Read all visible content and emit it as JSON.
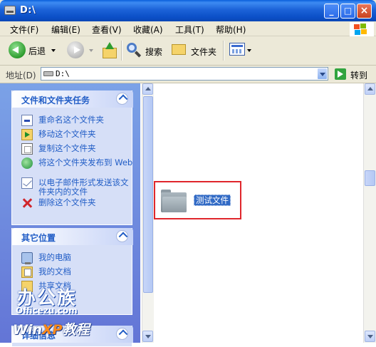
{
  "window": {
    "title": "D:\\"
  },
  "menu": {
    "items": [
      "文件(F)",
      "编辑(E)",
      "查看(V)",
      "收藏(A)",
      "工具(T)",
      "帮助(H)"
    ]
  },
  "toolbar": {
    "back_label": "后退",
    "search_label": "搜索",
    "folders_label": "文件夹"
  },
  "address": {
    "label": "地址(D)",
    "value": "D:\\",
    "go_label": "转到"
  },
  "tasks_panel": {
    "title": "文件和文件夹任务",
    "items": [
      {
        "label": "重命名这个文件夹",
        "icon": "rename-icon"
      },
      {
        "label": "移动这个文件夹",
        "icon": "move-icon"
      },
      {
        "label": "复制这个文件夹",
        "icon": "copy-icon"
      },
      {
        "label": "将这个文件夹发布到 Web",
        "icon": "web-publish-icon"
      },
      {
        "label": "以电子邮件形式发送该文件夹内的文件",
        "icon": "email-icon"
      },
      {
        "label": "删除这个文件夹",
        "icon": "delete-icon"
      }
    ]
  },
  "places_panel": {
    "title": "其它位置",
    "items": [
      {
        "label": "我的电脑",
        "icon": "my-computer-icon"
      },
      {
        "label": "我的文档",
        "icon": "my-documents-icon"
      },
      {
        "label": "共享文档",
        "icon": "shared-documents-icon"
      }
    ]
  },
  "details_panel": {
    "title": "详细信息"
  },
  "watermark": {
    "brand": "办公族",
    "site": "Officezu.com",
    "tagline_win": "Win",
    "tagline_xp": "XP",
    "tagline_rest": "教程"
  },
  "files": [
    {
      "name": "测试文件",
      "type": "folder",
      "selected": true
    }
  ],
  "colors": {
    "title_bar": "#0b4fc7",
    "task_pane": "#6f8fe0",
    "task_link": "#215dc6",
    "selection": "#316ac5",
    "highlight_box": "#e0262c"
  }
}
